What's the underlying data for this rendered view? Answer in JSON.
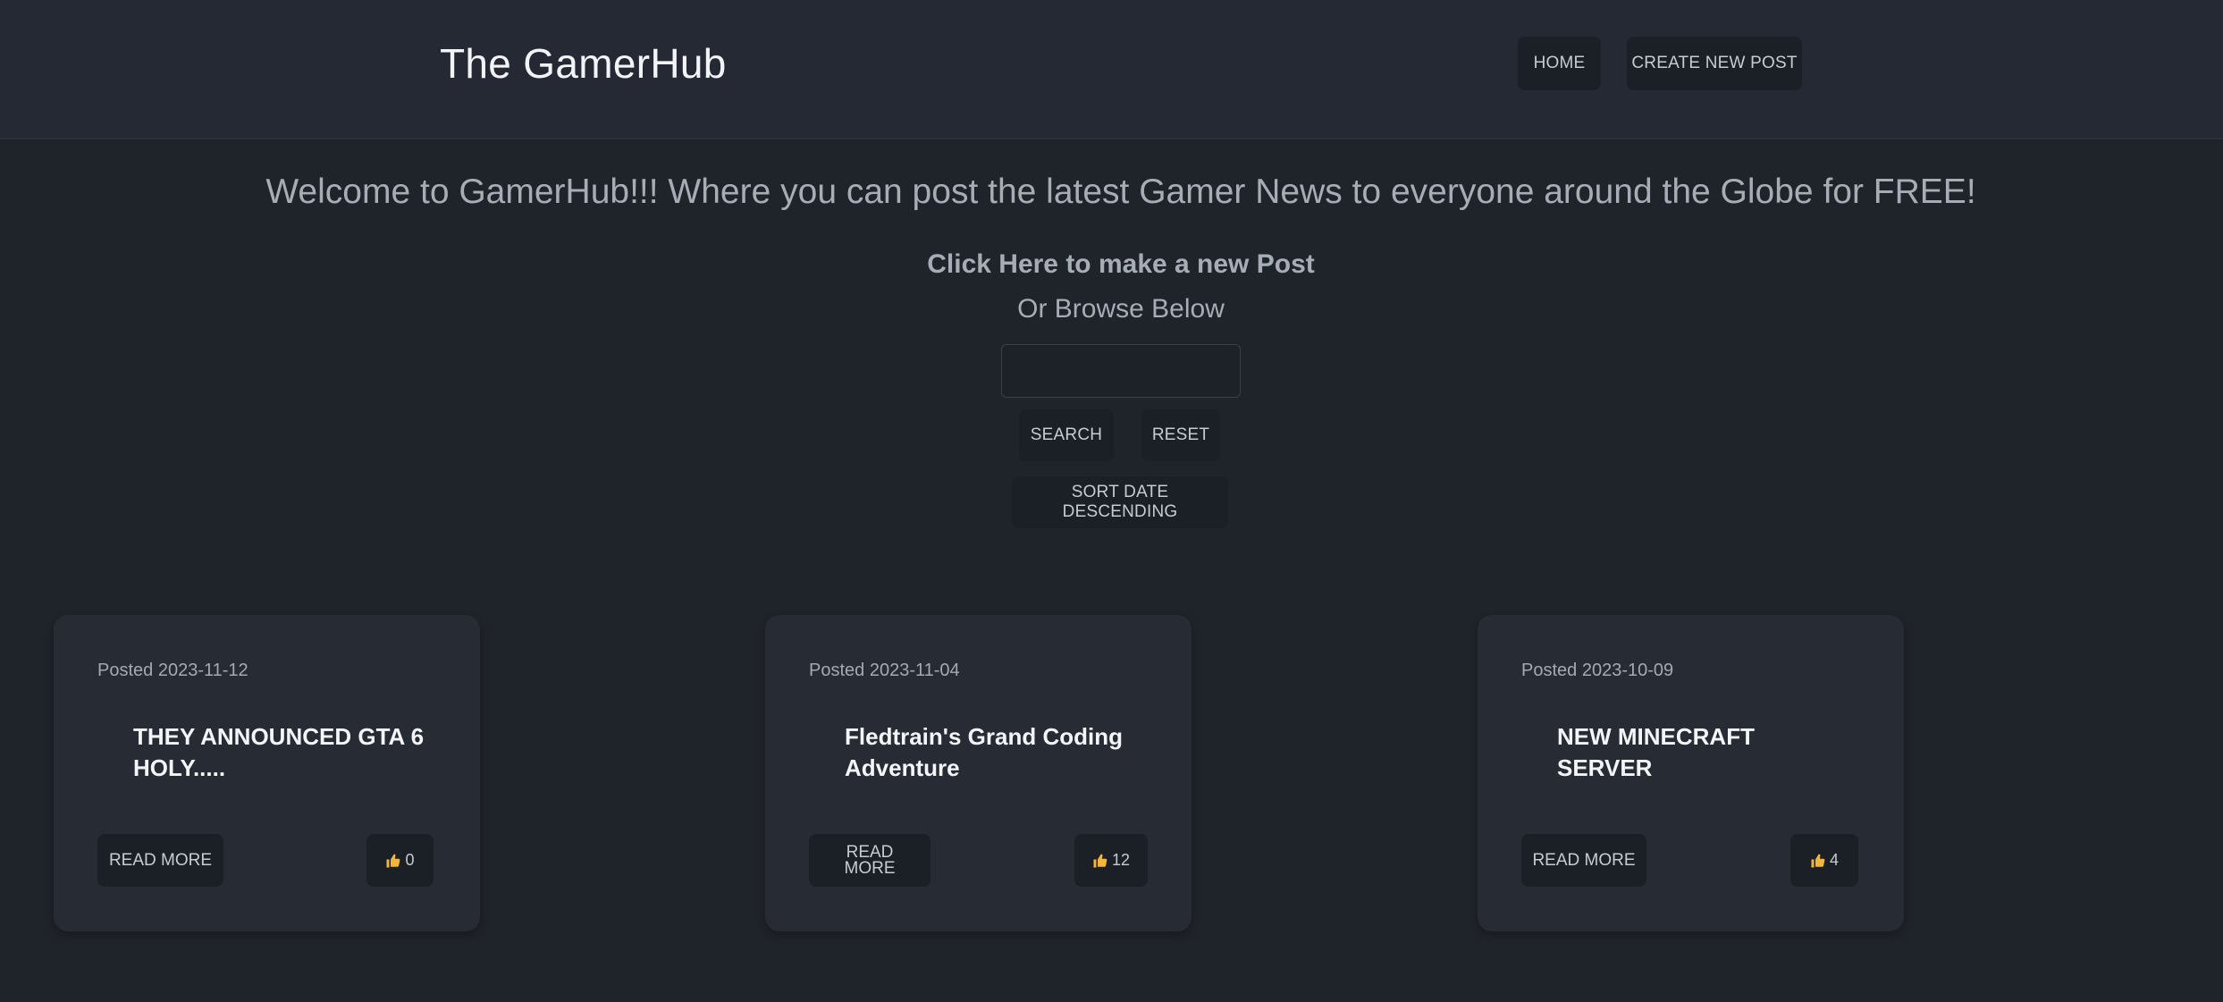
{
  "header": {
    "brand": "The GamerHub",
    "nav": {
      "home": "HOME",
      "create": "CREATE NEW POST"
    }
  },
  "main": {
    "welcome": "Welcome to GamerHub!!! Where you can post the latest Gamer News to everyone around the Globe for FREE!",
    "make_post_link": "Click Here to make a new Post",
    "browse": "Or Browse Below",
    "search": {
      "value": "",
      "placeholder": ""
    },
    "buttons": {
      "search": "SEARCH",
      "reset": "RESET",
      "sort": "SORT DATE DESCENDING"
    }
  },
  "posts": [
    {
      "date": "Posted 2023-11-12",
      "title": "THEY ANNOUNCED GTA 6 HOLY.....",
      "read_more": "READ MORE",
      "likes": "0",
      "like_icon": "thumbs-up-icon"
    },
    {
      "date": "Posted 2023-11-04",
      "title": "Fledtrain's Grand Coding Adventure",
      "read_more": "READ MORE",
      "likes": "12",
      "like_icon": "thumbs-up-icon"
    },
    {
      "date": "Posted 2023-10-09",
      "title": "NEW MINECRAFT SERVER",
      "read_more": "READ MORE",
      "likes": "4",
      "like_icon": "thumbs-up-icon"
    }
  ],
  "colors": {
    "background": "#1f232a",
    "navbar": "#242933",
    "card": "#262b34",
    "button": "#1b1f26",
    "thumb": "#f2b63c"
  }
}
